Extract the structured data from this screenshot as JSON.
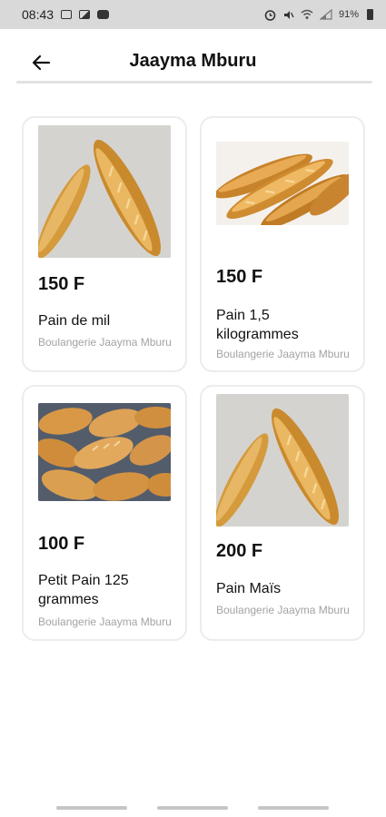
{
  "status_bar": {
    "time": "08:43",
    "left_icons": [
      "image-icon",
      "gallery-icon",
      "youtube-icon"
    ],
    "right_icons": [
      "alarm-icon",
      "mute-icon",
      "wifi-icon",
      "signal-icon"
    ],
    "battery": "91%"
  },
  "header": {
    "title": "Jaayma Mburu",
    "back_icon": "arrow-left-icon"
  },
  "products": [
    {
      "price": "150 F",
      "name": "Pain de mil",
      "seller": "Boulangerie Jaayma Mburu",
      "image": "baguettes-photo"
    },
    {
      "price": "150 F",
      "name": "Pain 1,5 kilogrammes",
      "seller": "Boulangerie Jaayma Mburu",
      "image": "baguettes-photo"
    },
    {
      "price": "100 F",
      "name": "Petit Pain 125 grammes",
      "seller": "Boulangerie Jaayma Mburu",
      "image": "small-breads-photo"
    },
    {
      "price": "200 F",
      "name": "Pain Maïs",
      "seller": "Boulangerie Jaayma Mburu",
      "image": "baguettes-photo"
    }
  ],
  "colors": {
    "status_bar_bg": "#d9d9d9",
    "card_border": "#ececec",
    "seller_text": "#a3a3a3",
    "bread": "#d9952f"
  }
}
